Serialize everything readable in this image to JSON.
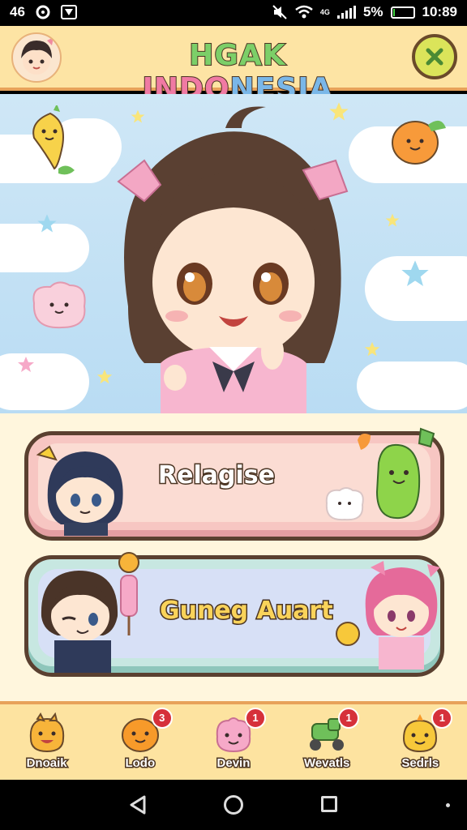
{
  "status_bar": {
    "left_text": "46",
    "battery_percent": "5%",
    "battery_level": 0.05,
    "time": "10:89",
    "network_label": "4G"
  },
  "header": {
    "title_part1": "HGAK ",
    "title_part2": "INDO",
    "title_part3": "NESIA"
  },
  "menu": {
    "card1_label": "Relagise",
    "card2_label": "Guneg Auart"
  },
  "bottom_nav": [
    {
      "label": "Dnoaik",
      "badge": ""
    },
    {
      "label": "Lodo",
      "badge": "3"
    },
    {
      "label": "Devin",
      "badge": "1"
    },
    {
      "label": "Wevatls",
      "badge": "1"
    },
    {
      "label": "Sedrls",
      "badge": "1"
    }
  ],
  "colors": {
    "header_bg": "#fde4a4",
    "accent_border": "#e7a25a",
    "close_button": "#dbe45a",
    "sky": "#cfe7f6",
    "card1": "#f7c6c2",
    "card2": "#c7e7e1",
    "badge": "#d6303a"
  },
  "icons": {
    "header_avatar": "anime-boy-avatar-icon",
    "close": "close-x-icon",
    "nav": [
      "orange-blob-icon",
      "orange-blob-icon",
      "pink-blob-icon",
      "green-car-icon",
      "yellow-blob-icon"
    ]
  }
}
